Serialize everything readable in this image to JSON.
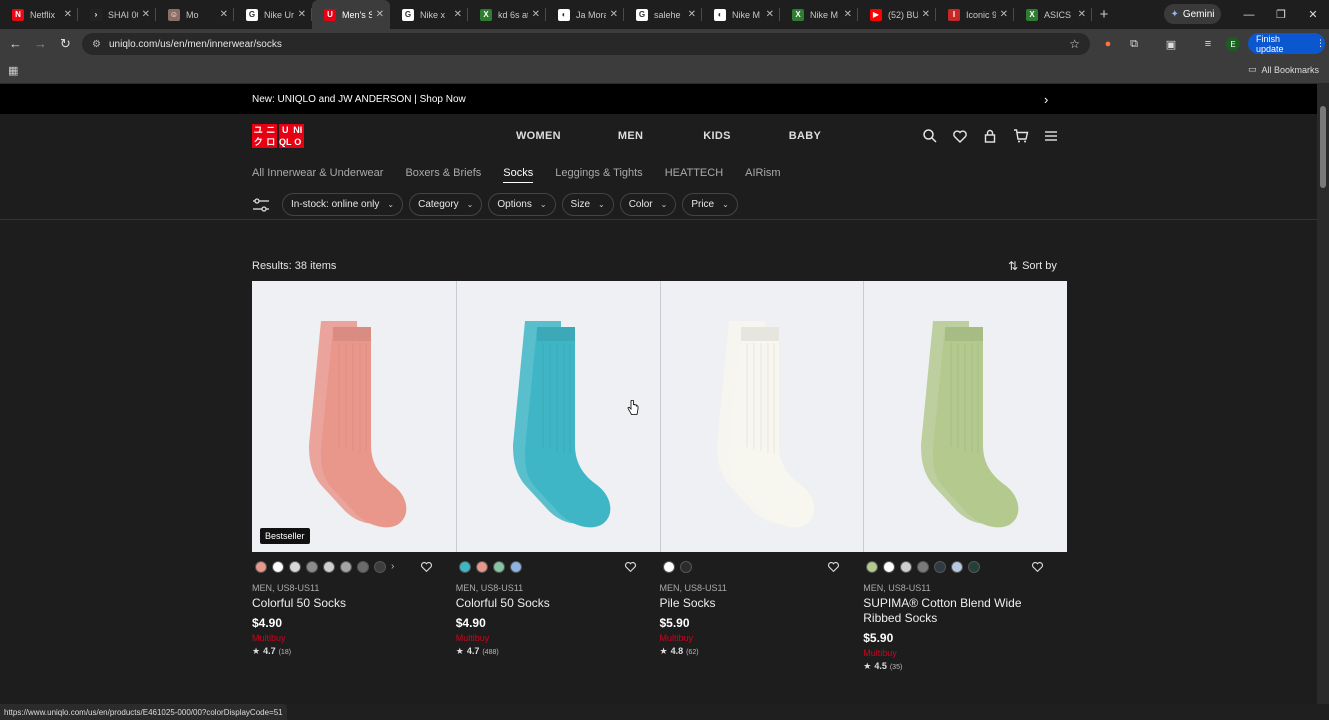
{
  "browser": {
    "tabs": [
      {
        "title": "Netflix",
        "color": "#e50914",
        "glyph": "N",
        "active": false
      },
      {
        "title": "SHAI 00",
        "color": "#222222",
        "glyph": "›",
        "active": false
      },
      {
        "title": "Mo",
        "color": "#8d6e63",
        "glyph": "☺",
        "active": false
      },
      {
        "title": "Nike Ur",
        "color": "#ffffff",
        "glyph": "G",
        "active": false
      },
      {
        "title": "Men's S",
        "color": "#e60012",
        "glyph": "U",
        "active": true
      },
      {
        "title": "Nike x",
        "color": "#ffffff",
        "glyph": "G",
        "active": false
      },
      {
        "title": "kd 6s at",
        "color": "#2e7d32",
        "glyph": "X",
        "active": false
      },
      {
        "title": "Ja Mora",
        "color": "#ffffff",
        "glyph": "◐",
        "active": false
      },
      {
        "title": "salehe",
        "color": "#ffffff",
        "glyph": "G",
        "active": false
      },
      {
        "title": "Nike M",
        "color": "#ffffff",
        "glyph": "◐",
        "active": false
      },
      {
        "title": "Nike M",
        "color": "#2e7d32",
        "glyph": "X",
        "active": false
      },
      {
        "title": "(52) BU",
        "color": "#ff0000",
        "glyph": "▶",
        "active": false
      },
      {
        "title": "Iconic 9",
        "color": "#c62828",
        "glyph": "I",
        "active": false
      },
      {
        "title": "ASICS C",
        "color": "#2e7d32",
        "glyph": "X",
        "active": false
      }
    ],
    "gemini_label": "Gemini",
    "url": "uniqlo.com/us/en/men/innerwear/socks",
    "profile_initial": "E",
    "finish_update": "Finish update",
    "all_bookmarks": "All Bookmarks",
    "status_url": "https://www.uniqlo.com/us/en/products/E461025-000/00?colorDisplayCode=51"
  },
  "promo": {
    "text": "New: UNIQLO and JW ANDERSON | Shop Now"
  },
  "logo": {
    "letters": [
      "ユ",
      "ニ",
      "ク",
      "ロ",
      "U",
      "NI",
      "QL",
      "O"
    ]
  },
  "nav": {
    "items": [
      "WOMEN",
      "MEN",
      "KIDS",
      "BABY"
    ]
  },
  "subnav": {
    "items": [
      "All Innerwear & Underwear",
      "Boxers & Briefs",
      "Socks",
      "Leggings & Tights",
      "HEATTECH",
      "AIRism"
    ],
    "active_index": 2
  },
  "filters": [
    "In-stock: online only",
    "Category",
    "Options",
    "Size",
    "Color",
    "Price"
  ],
  "results": {
    "label": "Results: 38 items",
    "sort": "Sort by"
  },
  "products": [
    {
      "badge": "Bestseller",
      "sock_color": "#e9978b",
      "swatches": [
        "#e9978b",
        "#ffffff",
        "#d9d9d9",
        "#8c8c8c",
        "#cfcfcf",
        "#a5a5a5",
        "#6b6b6b",
        "#3d3d3d"
      ],
      "more": "›",
      "meta": "MEN, US8-US11",
      "name": "Colorful 50 Socks",
      "price": "$4.90",
      "promo": "Multibuy",
      "rating": "4.7",
      "reviews": "(18)"
    },
    {
      "badge": "",
      "sock_color": "#3fb6c6",
      "swatches": [
        "#3fb6c6",
        "#e9978b",
        "#86c5a0",
        "#8eb4e3"
      ],
      "more": "",
      "meta": "MEN, US8-US11",
      "name": "Colorful 50 Socks",
      "price": "$4.90",
      "promo": "Multibuy",
      "rating": "4.7",
      "reviews": "(488)"
    },
    {
      "badge": "",
      "sock_color": "#f7f6ef",
      "swatches": [
        "#ffffff",
        "#2b2b2b"
      ],
      "more": "",
      "meta": "MEN, US8-US11",
      "name": "Pile Socks",
      "price": "$5.90",
      "promo": "Multibuy",
      "rating": "4.8",
      "reviews": "(62)"
    },
    {
      "badge": "",
      "sock_color": "#b4c98e",
      "swatches": [
        "#b4c98e",
        "#ffffff",
        "#cfcfcf",
        "#7a7a7a",
        "#2f3a44",
        "#b7c9e0",
        "#23403b"
      ],
      "more": "",
      "meta": "MEN, US8-US11",
      "name": "SUPIMA® Cotton Blend Wide Ribbed Socks",
      "price": "$5.90",
      "promo": "Multibuy",
      "rating": "4.5",
      "reviews": "(35)"
    }
  ]
}
